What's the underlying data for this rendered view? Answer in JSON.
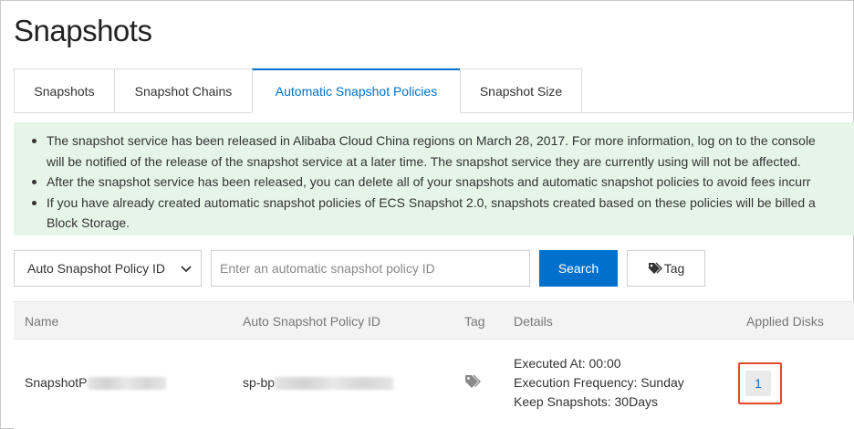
{
  "page": {
    "title": "Snapshots"
  },
  "tabs": [
    {
      "label": "Snapshots",
      "active": false
    },
    {
      "label": "Snapshot Chains",
      "active": false
    },
    {
      "label": "Automatic Snapshot Policies",
      "active": true
    },
    {
      "label": "Snapshot Size",
      "active": false
    }
  ],
  "notice": {
    "items": [
      {
        "line1": "The snapshot service has been released in Alibaba Cloud China regions on March 28, 2017. For more information, log on to the console",
        "line2": "will be notified of the release of the snapshot service at a later time. The snapshot service they are currently using will not be affected."
      },
      {
        "line1": "After the snapshot service has been released, you can delete all of your snapshots and automatic snapshot policies to avoid fees incurr"
      },
      {
        "line1": "If you have already created automatic snapshot policies of ECS Snapshot 2.0, snapshots created based on these policies will be billed a",
        "line2": "Block Storage."
      }
    ]
  },
  "filter": {
    "select_value": "Auto Snapshot Policy ID",
    "search_placeholder": "Enter an automatic snapshot policy ID",
    "search_label": "Search",
    "tag_label": "Tag"
  },
  "table": {
    "columns": {
      "name": "Name",
      "policy_id": "Auto Snapshot Policy ID",
      "tag": "Tag",
      "details": "Details",
      "applied_disks": "Applied Disks"
    },
    "rows": [
      {
        "name_prefix": "SnapshotP",
        "policy_id_prefix": "sp-bp",
        "details": {
          "executed_at": "Executed At: 00:00",
          "frequency": "Execution Frequency: Sunday",
          "keep": "Keep Snapshots: 30Days"
        },
        "applied_disks": "1"
      }
    ]
  },
  "colors": {
    "accent": "#0070cc",
    "notice_bg": "#e5f6e8",
    "highlight": "#e34a2b"
  }
}
